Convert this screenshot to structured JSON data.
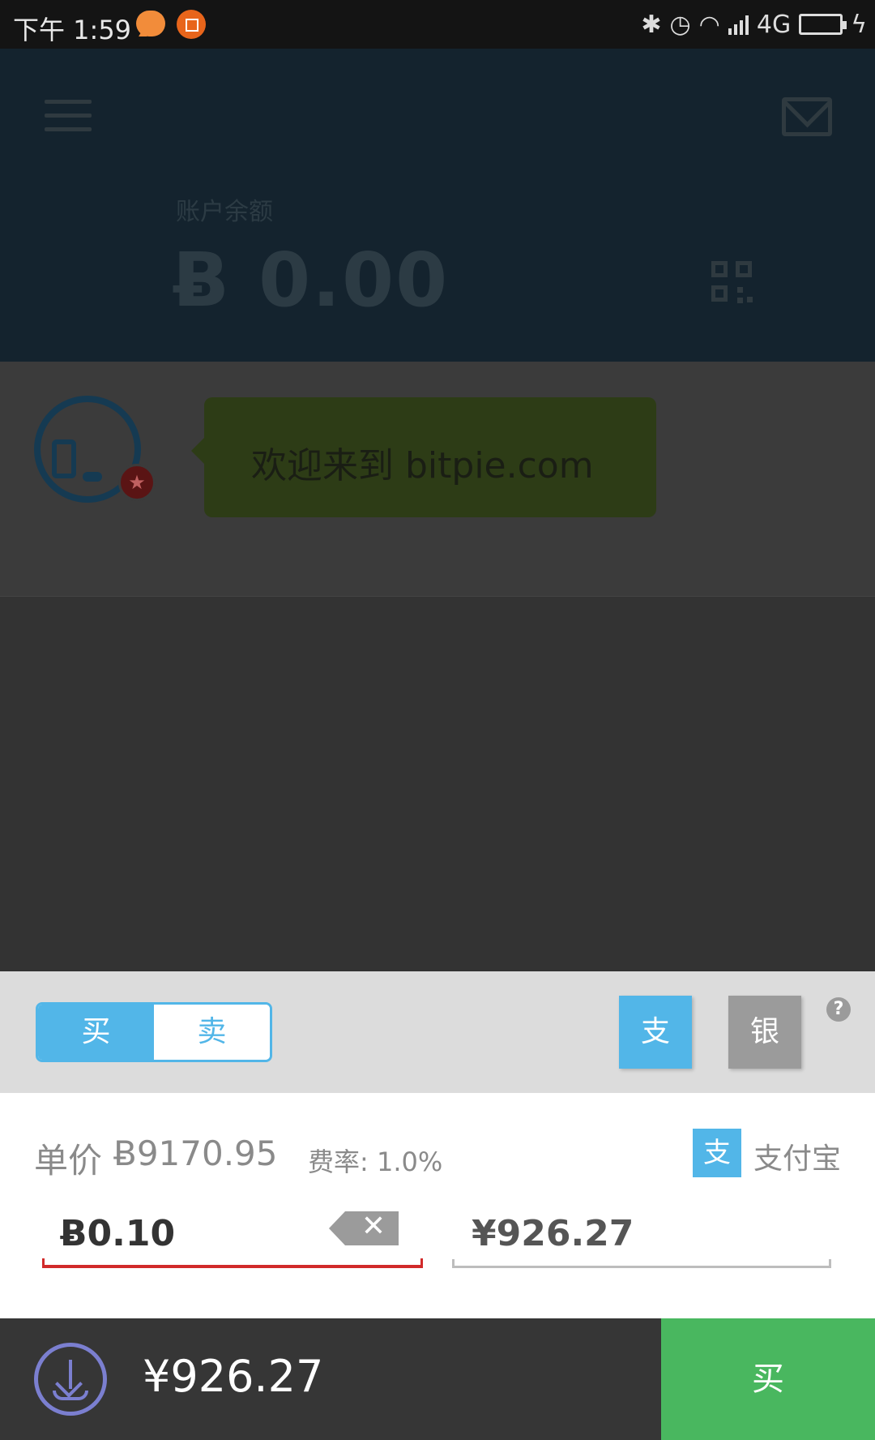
{
  "status_bar": {
    "time": "下午 1:59",
    "network": "4G"
  },
  "header": {
    "balance_label": "账户余额",
    "balance_value": "Ƀ 0.00"
  },
  "chat": {
    "message": "欢迎来到 bitpie.com"
  },
  "trade_panel": {
    "toggle": {
      "buy": "买",
      "sell": "卖",
      "selected": "buy"
    },
    "payment_methods": [
      {
        "label": "支",
        "name": "alipay",
        "selected": true
      },
      {
        "label": "银",
        "name": "bank",
        "selected": false
      }
    ],
    "help_symbol": "?",
    "price_label": "单价",
    "price_value": "Ƀ9170.95",
    "fee": "费率: 1.0%",
    "method_badge": "支",
    "method_name": "支付宝",
    "btc_amount": "Ƀ0.10",
    "cny_amount": "¥926.27"
  },
  "footer": {
    "total": "¥926.27",
    "buy_button": "买"
  },
  "colors": {
    "accent_blue": "#52b6e8",
    "buy_green": "#49b75f",
    "input_error_red": "#d12a2a"
  }
}
